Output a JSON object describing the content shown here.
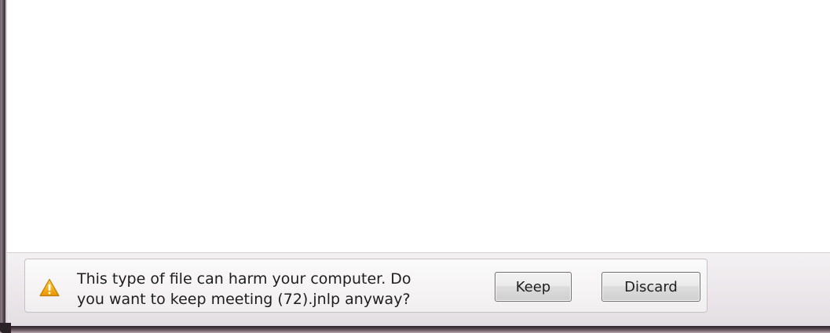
{
  "download_shelf": {
    "warning_line1": "This type of file can harm your computer. Do",
    "warning_line2": "you want to keep meeting (72).jnlp anyway?",
    "keep_label": "Keep",
    "discard_label": "Discard",
    "icon": "warning-icon",
    "icon_color": "#f0a400"
  }
}
